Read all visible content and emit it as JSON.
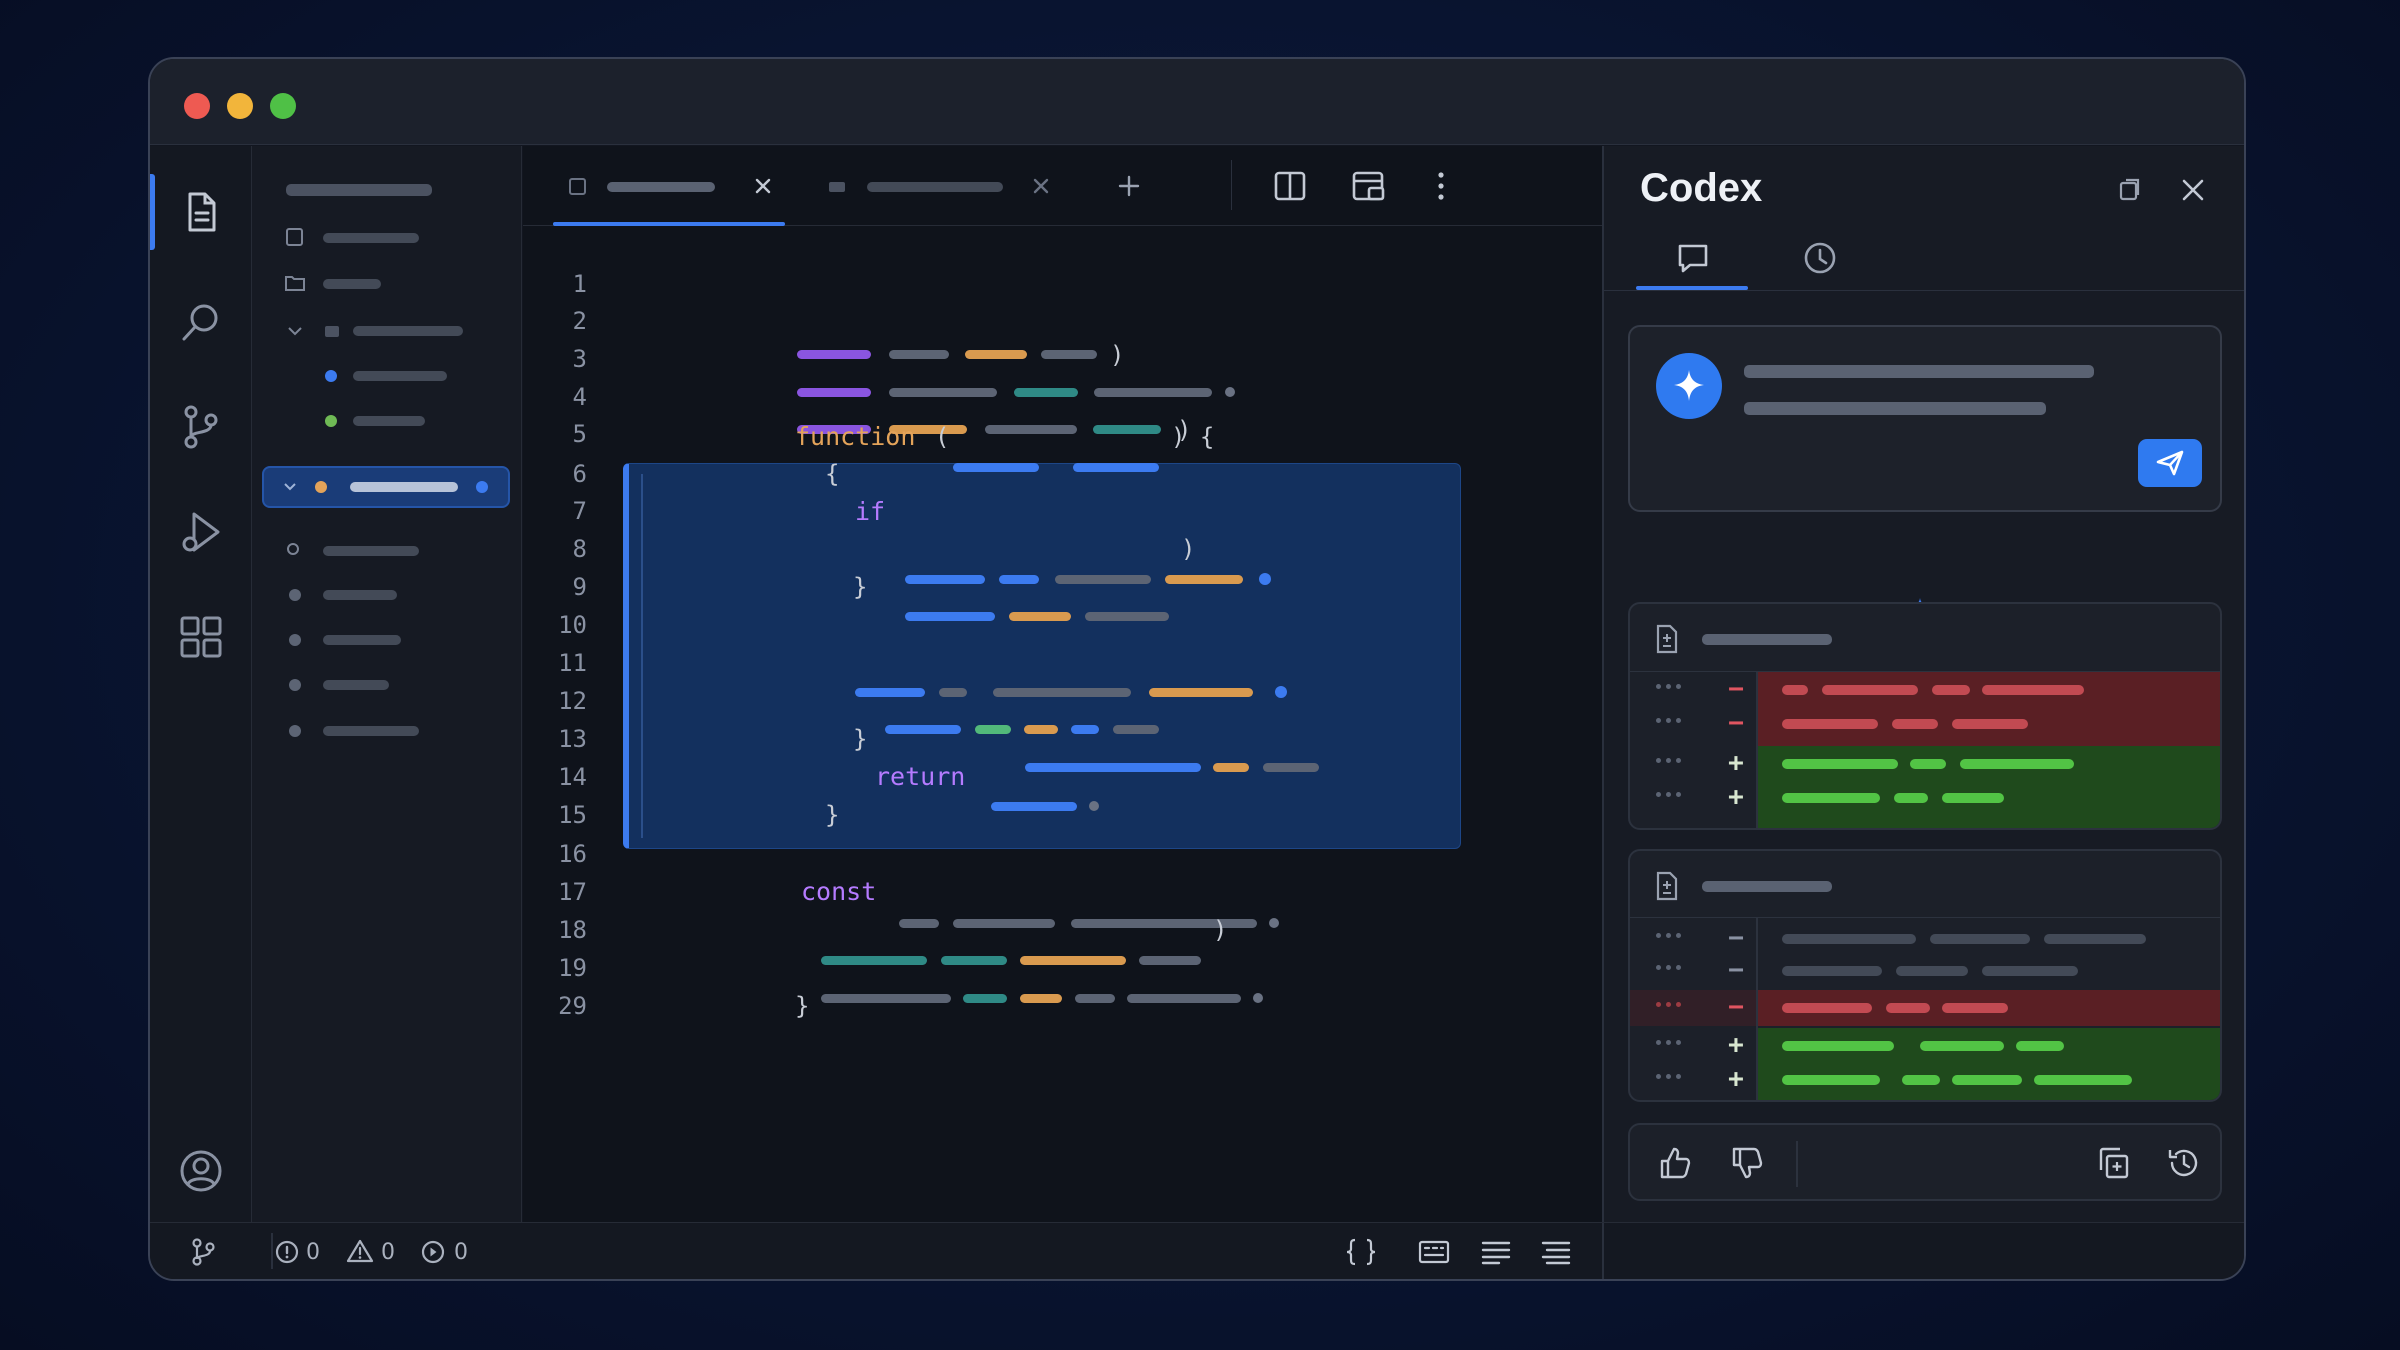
{
  "colors": {
    "accent": "#3c7bf0",
    "keyword": "#e3a35a",
    "keyword_purple": "#b57bff",
    "diff_removed": "#5a1f24",
    "diff_added": "#1f4a1c"
  },
  "codex": {
    "title": "Codex",
    "tabs": [
      {
        "icon": "chat-icon"
      },
      {
        "icon": "clock-icon"
      }
    ]
  },
  "editor": {
    "line_numbers": [
      "1",
      "2",
      "3",
      "4",
      "5",
      "6",
      "7",
      "8",
      "9",
      "10",
      "11",
      "12",
      "13",
      "14",
      "15",
      "16",
      "17",
      "18",
      "19",
      "29"
    ],
    "keywords": {
      "function": "function",
      "if": "if",
      "return": "return",
      "const": "const"
    },
    "punct": {
      "paren_open": "(",
      "brace_open": "{",
      "brace_close": "}",
      "paren_close": ")",
      "function_tail": ") {"
    }
  },
  "status": {
    "errors": "0",
    "warnings": "0",
    "info": "0"
  },
  "diff": {
    "minus": "−",
    "plus": "+"
  }
}
